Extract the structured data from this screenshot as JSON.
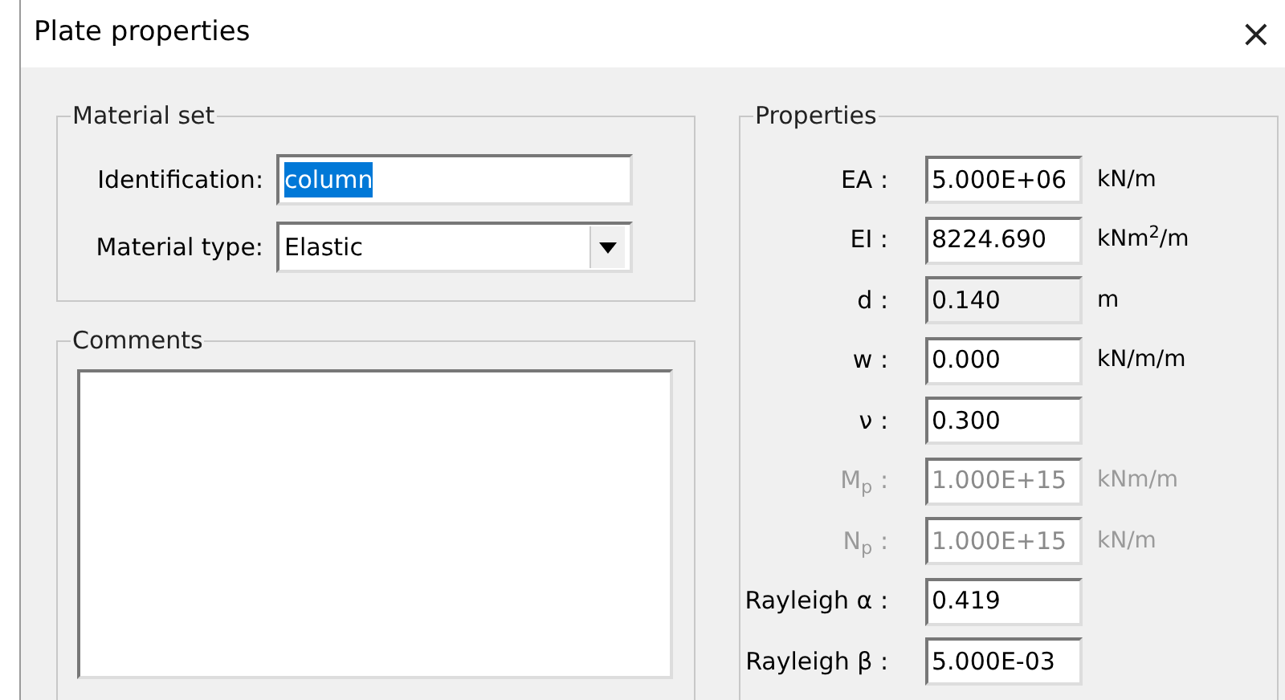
{
  "window": {
    "title": "Plate properties",
    "close": "×"
  },
  "material_set": {
    "title": "Material set",
    "identification": {
      "label": "Identification:",
      "value": "column",
      "value_selected": true
    },
    "material_type": {
      "label": "Material type:",
      "value": "Elastic"
    }
  },
  "comments": {
    "title": "Comments"
  },
  "properties": {
    "title": "Properties",
    "rows": [
      {
        "label": "EA :",
        "value": "5.000E+06",
        "unit": "kN/m",
        "disabled": false,
        "readonly": false
      },
      {
        "label": "EI :",
        "value": "8224.690",
        "unit": "kNm$^{2}$/m",
        "disabled": false,
        "readonly": false
      },
      {
        "label": "d :",
        "value": "0.140",
        "unit": "m",
        "disabled": false,
        "readonly": true
      },
      {
        "label": "w :",
        "value": "0.000",
        "unit": "kN/m/m",
        "disabled": false,
        "readonly": false
      },
      {
        "label": "ν :",
        "value": "0.300",
        "disabled": false,
        "readonly": false
      },
      {
        "label": "M$_{p}$ :",
        "value": "1.000E+15",
        "unit": "kNm/m",
        "disabled": true,
        "readonly": false
      },
      {
        "label": "N$_{p}$ :",
        "value": "1.000E+15",
        "unit": "kN/m",
        "disabled": true,
        "readonly": false
      },
      {
        "label": "Rayleigh α :",
        "value": "0.419",
        "disabled": false,
        "readonly": false
      },
      {
        "label": "Rayleigh β :",
        "value": "5.000E-03",
        "disabled": false,
        "readonly": false
      }
    ]
  }
}
